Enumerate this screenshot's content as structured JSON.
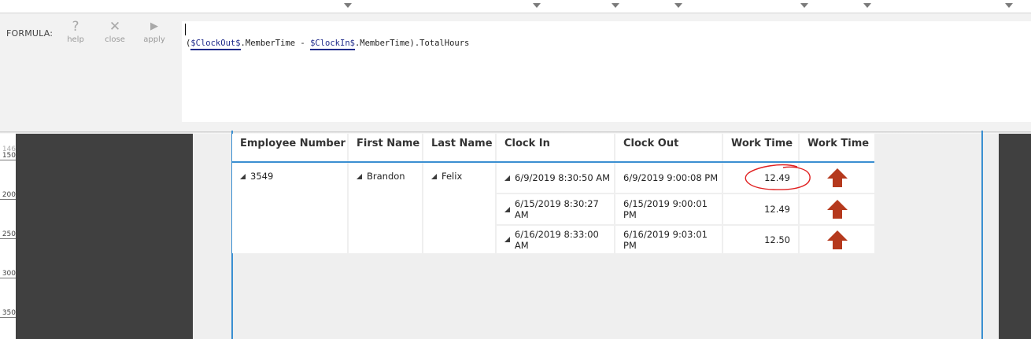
{
  "formula_bar": {
    "label": "FORMULA:",
    "buttons": [
      {
        "label": "help",
        "icon": "question-icon",
        "glyph": "?"
      },
      {
        "label": "close",
        "icon": "close-icon",
        "glyph": "✕"
      },
      {
        "label": "apply",
        "icon": "play-icon",
        "glyph": "▶"
      }
    ],
    "formula": {
      "open": "(",
      "token1": "$ClockOut$",
      "mid": ".MemberTime - ",
      "token2": "$ClockIn$",
      "end": ".MemberTime).TotalHours"
    }
  },
  "ruler": {
    "marks": [
      "146",
      "150",
      "200",
      "250",
      "300",
      "350"
    ]
  },
  "table": {
    "headers": [
      "Employee Number",
      "First Name",
      "Last Name",
      "Clock In",
      "Clock Out",
      "Work Time",
      "Work Time"
    ],
    "group": {
      "employee_number": "3549",
      "first_name": "Brandon",
      "last_name": "Felix"
    },
    "rows": [
      {
        "clock_in": "6/9/2019 8:30:50 AM",
        "clock_out": "6/9/2019 9:00:08 PM",
        "work_time": "12.49",
        "indicator": "arrow-up-icon"
      },
      {
        "clock_in": "6/15/2019 8:30:27 AM",
        "clock_out": "6/15/2019 9:00:01 PM",
        "work_time": "12.49",
        "indicator": "arrow-up-icon"
      },
      {
        "clock_in": "6/16/2019 8:33:00 AM",
        "clock_out": "6/16/2019 9:03:01 PM",
        "work_time": "12.50",
        "indicator": "arrow-up-icon"
      }
    ]
  },
  "colors": {
    "accent": "#3a8fd1",
    "arrow": "#b5391d",
    "annotation": "#e02020",
    "token": "#1f2a8a"
  }
}
